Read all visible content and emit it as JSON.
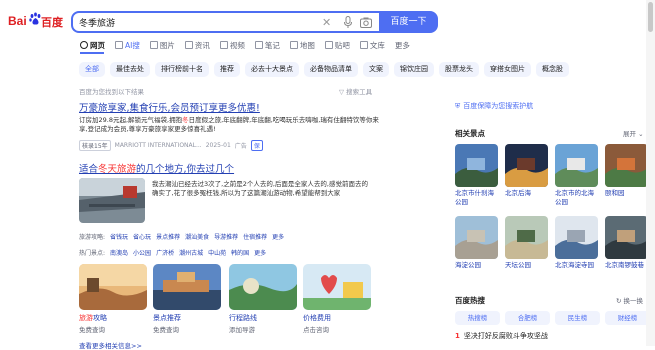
{
  "logo": {
    "bai": "Bai",
    "cn": "百度"
  },
  "search": {
    "query": "冬季旅游",
    "button_label": "百度一下"
  },
  "nav": {
    "tabs": [
      {
        "label": "网页",
        "icon": "search-icon"
      },
      {
        "label": "AI搜",
        "icon": "ai-icon"
      },
      {
        "label": "图片",
        "icon": "image-icon"
      },
      {
        "label": "资讯",
        "icon": "news-icon"
      },
      {
        "label": "视频",
        "icon": "video-icon"
      },
      {
        "label": "笔记",
        "icon": "note-icon"
      },
      {
        "label": "地图",
        "icon": "map-icon"
      },
      {
        "label": "贴吧",
        "icon": "tieba-icon"
      },
      {
        "label": "文库",
        "icon": "doc-icon"
      },
      {
        "label": "更多",
        "icon": ""
      }
    ]
  },
  "chips": [
    "全部",
    "最佳去处",
    "排行榜前十名",
    "推荐",
    "必去十大景点",
    "必备物品清单",
    "文案",
    "锦饮庄园",
    "股票龙头",
    "穿搭女图片",
    "概念股"
  ],
  "result_count": "百度为您找到以下结果",
  "search_tools": "搜索工具",
  "r1": {
    "title": "万豪旅享家,集食行乐,会员预订享更多优惠!",
    "desc1": "订房加29.8元起,解锁元气福袋,拥抱",
    "desc_hl": "冬",
    "desc2": "日度假之旅,年底翻牌,年底翻,吃喝玩乐去嗨咖,瑞有住翻特饮等你来享,登记成为会员,尊享万豪旅享家更多惊喜礼遇!",
    "meta_rating": "核录15年",
    "meta_site": "MARRIOTT INTERNATIONAL...",
    "meta_date": "2025-01",
    "meta_ad": "广告",
    "meta_v": "保"
  },
  "r2": {
    "title_pre": "适合",
    "title_hl": "冬天旅游",
    "title_post": "的几个地方,你去过几个",
    "desc": "我去潮汕已经去过3次了,之前是2个人去的,后面是全家人去的,感觉前面去的确实了,花了很多冤枉钱,所以为了这篇潮汕游动物,希望能帮到大家",
    "links_label": "旅游攻略:",
    "links": [
      "省钱玩",
      "省心玩",
      "景点推荐",
      "潮汕美食",
      "导游推荐",
      "住宿推荐",
      "更多"
    ],
    "links2_label": "热门景点:",
    "links2": [
      "南澳岛",
      "小公园",
      "广济桥",
      "潮州古城",
      "中山苑",
      "韩的国",
      "更多"
    ]
  },
  "cards": [
    {
      "t1_hl": "旅游",
      "t1": "攻略",
      "t2": "免费查询"
    },
    {
      "t1": "景点推荐",
      "t2": "免费查询"
    },
    {
      "t1": "行程路线",
      "t2": "添加导游"
    },
    {
      "t1": "价格费用",
      "t2": "点击咨询"
    }
  ],
  "more_links": "查看更多相关信息>>",
  "right": {
    "protect": "百度保障为您搜索护航",
    "related_title": "相关景点",
    "expand": "展开",
    "spots": [
      "北京市什刹海公园",
      "北京后海",
      "北京市的北海公园",
      "颐和园",
      "海淀公园",
      "天坛公园",
      "北京海淀寺园",
      "北京南锣鼓巷"
    ],
    "hot_title": "百度热搜",
    "hot_refresh": "换一换",
    "hot_tabs": [
      "热搜榜",
      "合肥榜",
      "民生榜",
      "财经榜"
    ],
    "hot_item_rank": "1",
    "hot_item": "坚决打好反腐败斗争攻坚战"
  }
}
